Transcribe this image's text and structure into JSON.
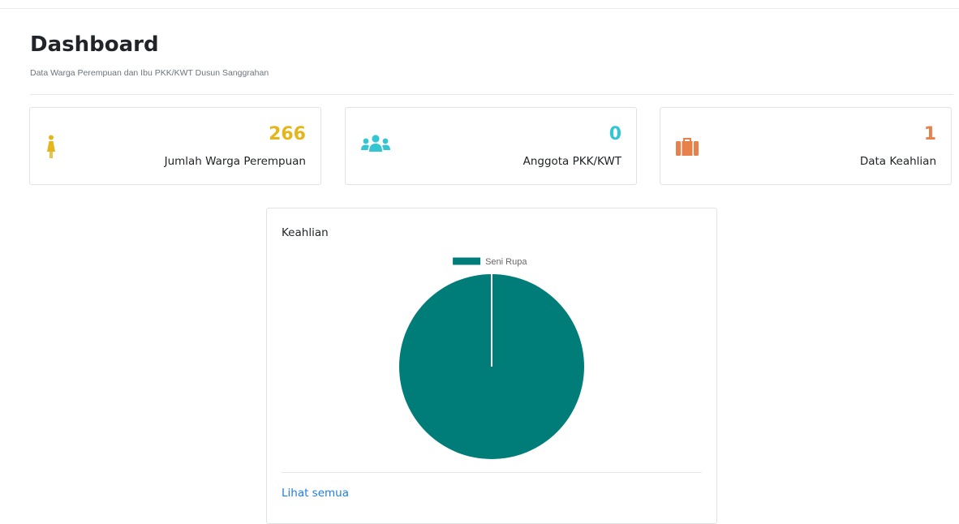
{
  "header": {
    "title": "Dashboard",
    "subtitle": "Data Warga Perempuan dan Ibu PKK/KWT Dusun Sanggrahan"
  },
  "stats": [
    {
      "value": "266",
      "label": "Jumlah Warga Perempuan",
      "icon": "female-icon",
      "color": "#e4b61c"
    },
    {
      "value": "0",
      "label": "Anggota PKK/KWT",
      "icon": "users-icon",
      "color": "#33c6d2"
    },
    {
      "value": "1",
      "label": "Data Keahlian",
      "icon": "briefcase-icon",
      "color": "#e8804c"
    }
  ],
  "chart_card": {
    "title": "Keahlian",
    "link_label": "Lihat semua"
  },
  "chart_data": {
    "type": "pie",
    "title": "",
    "legend_position": "top",
    "slices": [
      {
        "label": "Seni Rupa",
        "value": 1,
        "color": "#007d78"
      }
    ]
  }
}
